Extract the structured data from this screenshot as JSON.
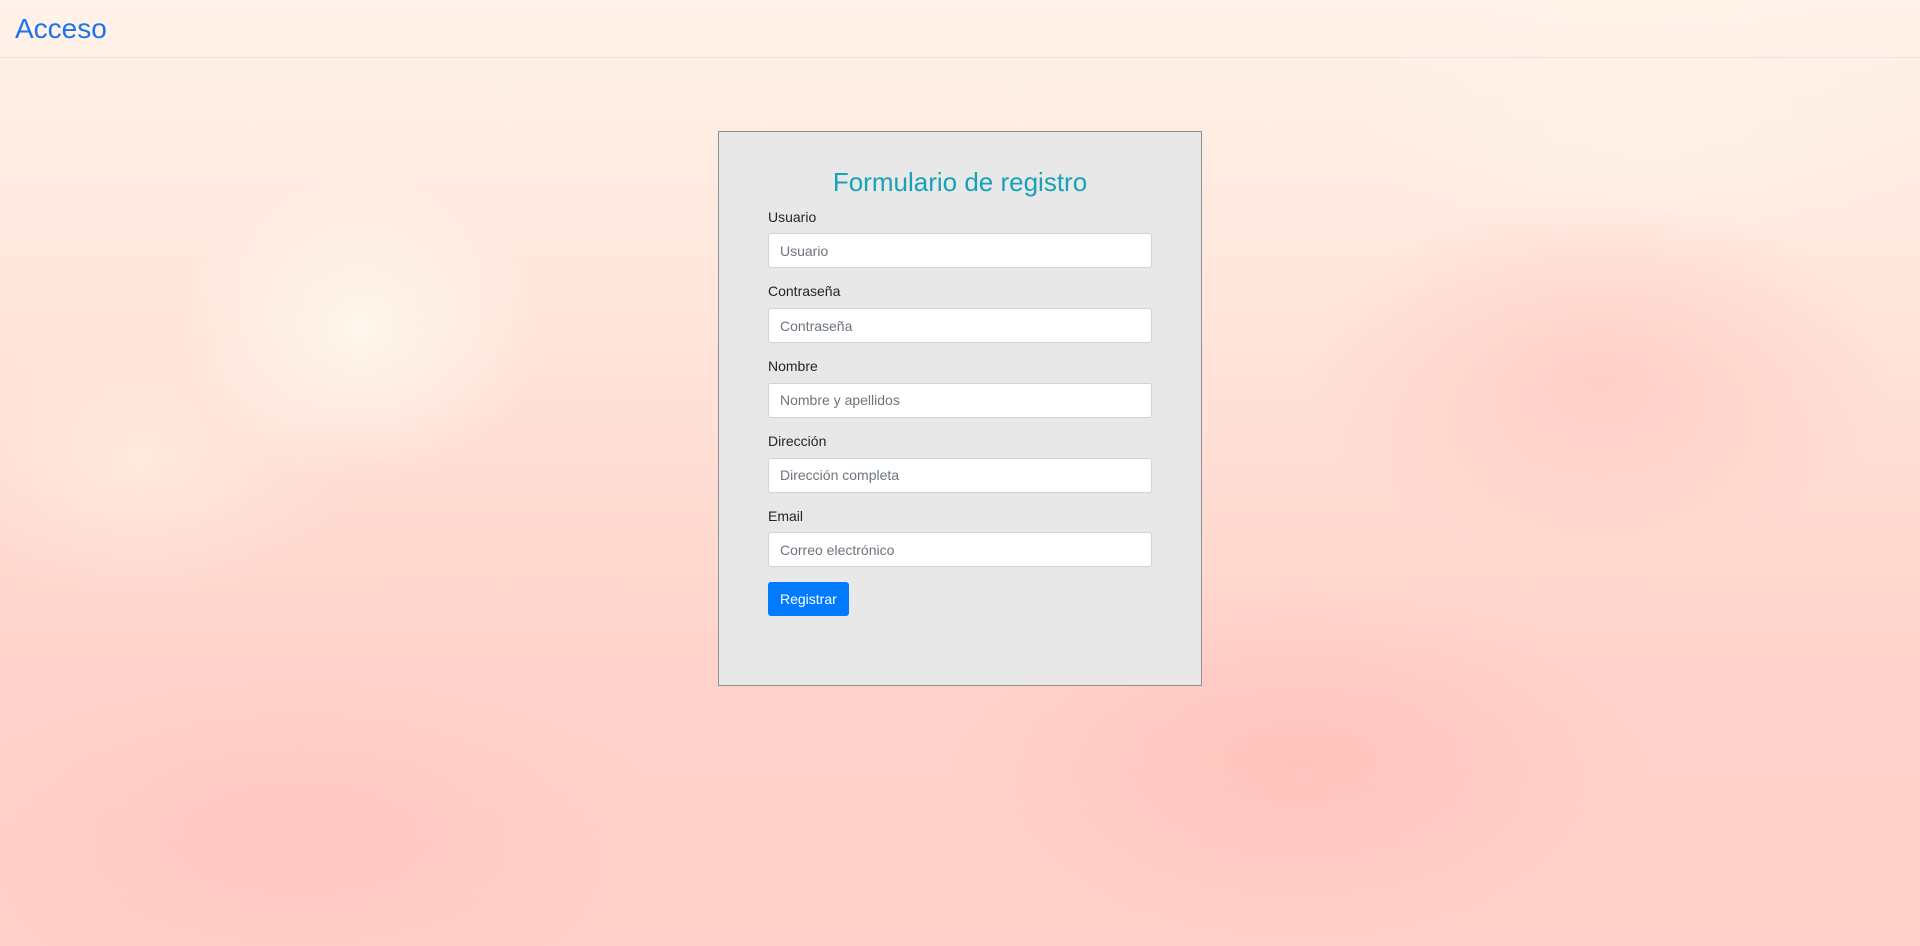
{
  "navbar": {
    "brand": "Acceso"
  },
  "form": {
    "title": "Formulario de registro",
    "fields": [
      {
        "label": "Usuario",
        "placeholder": "Usuario",
        "value": ""
      },
      {
        "label": "Contraseña",
        "placeholder": "Contraseña",
        "value": ""
      },
      {
        "label": "Nombre",
        "placeholder": "Nombre y apellidos",
        "value": ""
      },
      {
        "label": "Dirección",
        "placeholder": "Dirección completa",
        "value": ""
      },
      {
        "label": "Email",
        "placeholder": "Correo electrónico",
        "value": ""
      }
    ],
    "submit_label": "Registrar"
  },
  "colors": {
    "brand": "#1a73f0",
    "title": "#17a2b8",
    "primary_button": "#007bff",
    "panel_background": "#e8e8e8"
  }
}
